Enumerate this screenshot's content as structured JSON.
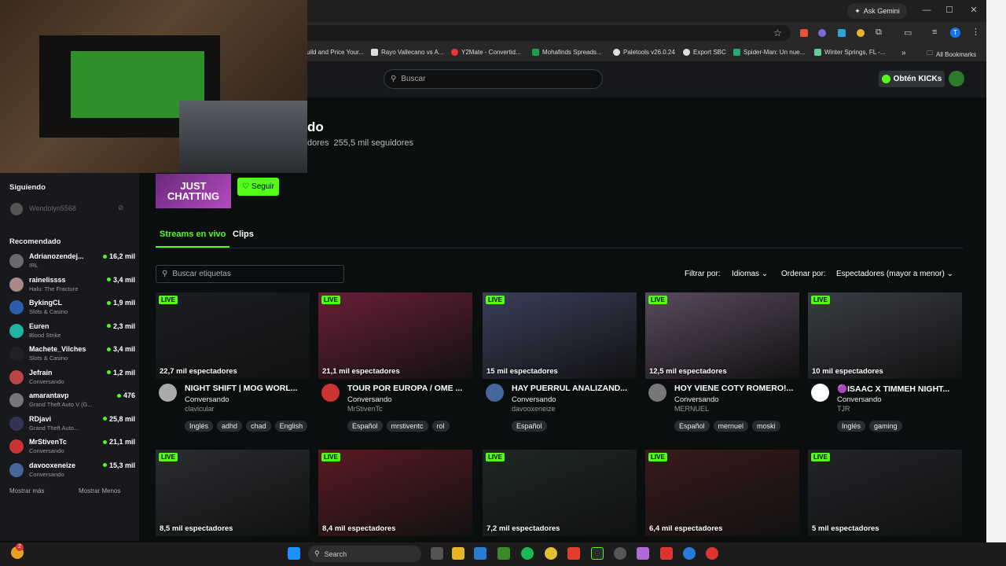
{
  "browser": {
    "ask_gemini": "Ask Gemini",
    "bookmarks": [
      {
        "label": "uild and Price Your...",
        "color": "#888"
      },
      {
        "label": "Rayo Vallecano vs A...",
        "color": "#ddd"
      },
      {
        "label": "Y2Mate - Convertid...",
        "color": "#e33"
      },
      {
        "label": "Mohafinds Spreads...",
        "color": "#1e9e4a"
      },
      {
        "label": "Paletools v26.0.24",
        "color": "#ddd"
      },
      {
        "label": "Export SBC",
        "color": "#ddd"
      },
      {
        "label": "Spider-Man: Un nue...",
        "color": "#2a7"
      },
      {
        "label": "Winter Springs, FL -...",
        "color": "#6c9"
      }
    ],
    "all_bookmarks": "All Bookmarks",
    "more": "»"
  },
  "topnav": {
    "search_placeholder": "Buscar",
    "kicks_label": "Obtén KICKs"
  },
  "category": {
    "title_fragment": "do",
    "viewers_fragment": "dores",
    "followers": "255,5 mil seguidores",
    "thumb_line1": "JUST",
    "thumb_line2": "CHATTING",
    "follow_label": "Seguir"
  },
  "sidebar": {
    "following_heading": "Siguiendo",
    "following_user": "Wendolyn5568",
    "recommended_heading": "Recomendado",
    "recommended": [
      {
        "name": "Adrianozendej...",
        "category": "IRL",
        "viewers": "16,2 mil",
        "color": "#6b6b6b"
      },
      {
        "name": "rainelissss",
        "category": "Halu: The Fracture",
        "viewers": "3,4 mil",
        "color": "#a88"
      },
      {
        "name": "BykingCL",
        "category": "Slots & Casino",
        "viewers": "1,9 mil",
        "color": "#2a5ea8"
      },
      {
        "name": "Euren",
        "category": "Blood Strike",
        "viewers": "2,3 mil",
        "color": "#1fb5a0"
      },
      {
        "name": "Machete_Vilches",
        "category": "Slots & Casino",
        "viewers": "3,4 mil",
        "color": "#222"
      },
      {
        "name": "Jefrain",
        "category": "Conversando",
        "viewers": "1,2 mil",
        "color": "#b44"
      },
      {
        "name": "amarantavp",
        "category": "Grand Theft Auto V (G...",
        "viewers": "476",
        "color": "#777"
      },
      {
        "name": "RDjavi",
        "category": "Grand Theft Auto...",
        "viewers": "25,8 mil",
        "color": "#335"
      },
      {
        "name": "MrStivenTc",
        "category": "Conversando",
        "viewers": "21,1 mil",
        "color": "#c33"
      },
      {
        "name": "davooxeneize",
        "category": "Conversando",
        "viewers": "15,3 mil",
        "color": "#469"
      }
    ],
    "show_more": "Mostrar más",
    "show_less": "Mostrar Menos"
  },
  "tabs": {
    "live": "Streams en vivo",
    "clips": "Clips"
  },
  "filters": {
    "tag_search_placeholder": "Buscar etiquetas",
    "filter_by": "Filtrar por:",
    "languages": "Idiomas",
    "sort_by": "Ordenar por:",
    "sort_value": "Espectadores (mayor a menor)"
  },
  "live_badge": "LIVE",
  "streams": [
    {
      "viewers": "22,7 mil espectadores",
      "title": "NIGHT SHIFT | MOG WORL...",
      "category": "Conversando",
      "channel": "clavicular",
      "tags": [
        "Inglés",
        "adhd",
        "chad",
        "English"
      ],
      "bg": "#1b1d22",
      "avatar": "#aaa"
    },
    {
      "viewers": "21,1 mil espectadores",
      "title": "TOUR POR EUROPA / OME ...",
      "category": "Conversando",
      "channel": "MrStivenTc",
      "tags": [
        "Español",
        "mrstiventc",
        "rol"
      ],
      "bg": "#6a1e3a",
      "avatar": "#c33"
    },
    {
      "viewers": "15 mil espectadores",
      "title": "HAY PUERRUL ANALIZAND...",
      "category": "Conversando",
      "channel": "davooxeneize",
      "tags": [
        "Español"
      ],
      "bg": "#3a3f5a",
      "avatar": "#469"
    },
    {
      "viewers": "12,5 mil espectadores",
      "title": "HOY VIENE COTY ROMERO!...",
      "category": "Conversando",
      "channel": "MERNUEL",
      "tags": [
        "Español",
        "mernuel",
        "moski"
      ],
      "bg": "#5a4a5e",
      "avatar": "#777"
    },
    {
      "viewers": "10 mil espectadores",
      "title": "🟣ISAAC X TIMMEH NIGHT...",
      "category": "Conversando",
      "channel": "TJR",
      "tags": [
        "Inglés",
        "gaming"
      ],
      "bg": "#3a3d44",
      "avatar": "#fff"
    },
    {
      "viewers": "8,5 mil espectadores",
      "bg": "#2a2c30"
    },
    {
      "viewers": "8,4 mil espectadores",
      "bg": "#5a1a22"
    },
    {
      "viewers": "7,2 mil espectadores",
      "bg": "#1e2824"
    },
    {
      "viewers": "6,4 mil espectadores",
      "bg": "#3a1a1a"
    },
    {
      "viewers": "5 mil espectadores",
      "bg": "#222428"
    }
  ],
  "taskbar": {
    "search_placeholder": "Search",
    "notification_count": "2"
  }
}
